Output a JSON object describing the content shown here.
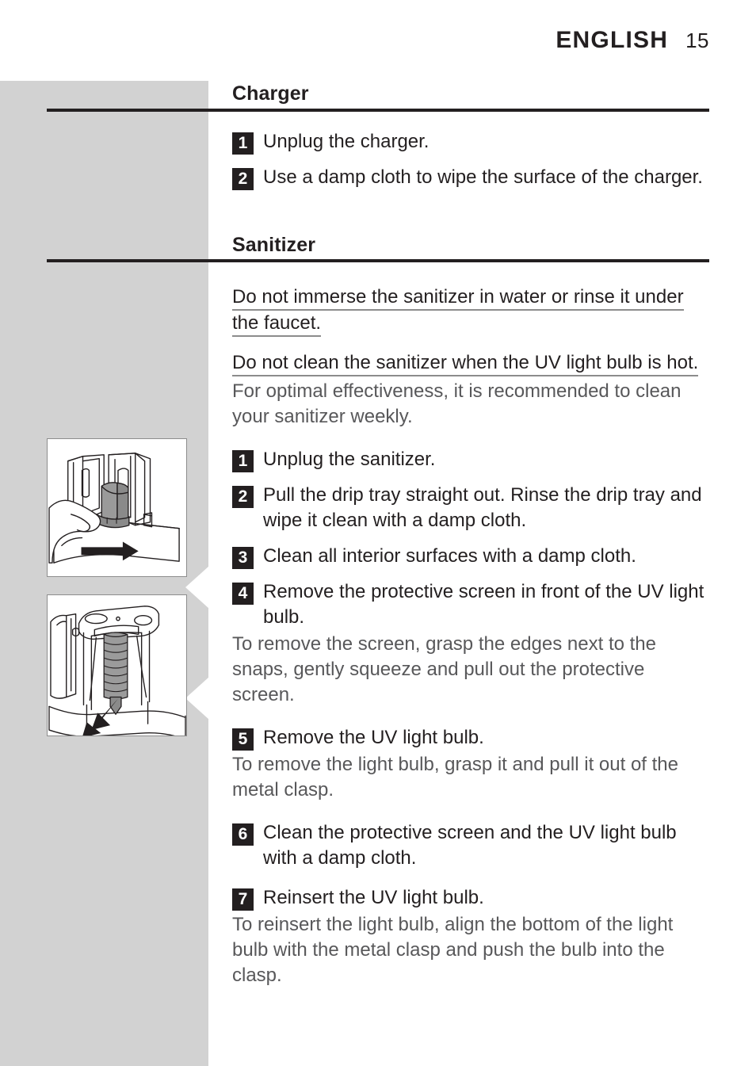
{
  "header": {
    "language": "ENGLISH",
    "page_number": "15"
  },
  "sections": [
    {
      "title": "Charger",
      "steps": [
        {
          "number": "1",
          "text": "Unplug the charger."
        },
        {
          "number": "2",
          "text": "Use a damp cloth to wipe the surface of the charger."
        }
      ]
    },
    {
      "title": "Sanitizer",
      "warnings": [
        "Do not immerse the sanitizer in water or rinse it under the faucet.",
        "Do not clean the sanitizer when the UV light bulb is hot."
      ],
      "intro": "For optimal effectiveness, it is recommended to clean your sanitizer weekly.",
      "steps": [
        {
          "number": "1",
          "text": "Unplug the sanitizer."
        },
        {
          "number": "2",
          "text": "Pull the drip tray straight out. Rinse the drip tray and wipe it clean with a damp cloth."
        },
        {
          "number": "3",
          "text": "Clean all interior surfaces with a damp cloth."
        },
        {
          "number": "4",
          "text": "Remove the protective screen in front of the UV light bulb."
        },
        {
          "number": "5",
          "text": "Remove the UV light bulb."
        },
        {
          "number": "6",
          "text": "Clean the protective screen and the UV light bulb with a damp cloth."
        },
        {
          "number": "7",
          "text": "Reinsert the UV light bulb."
        }
      ],
      "notes": {
        "after_step_4": "To remove the screen, grasp the edges next to the snaps, gently squeeze and pull out the protective screen.",
        "after_step_5": "To remove the light bulb, grasp it and pull it out of the metal clasp.",
        "after_step_7": "To reinsert the light bulb, align the bottom of the light bulb with the metal clasp and push the bulb into the clasp."
      }
    }
  ],
  "illustrations": [
    {
      "name": "drip-tray-removal-illustration",
      "caption": ""
    },
    {
      "name": "uv-bulb-removal-illustration",
      "caption": ""
    }
  ],
  "colors": {
    "ink": "#231f20",
    "body_text": "#58585a",
    "side_panel": "#d2d2d2",
    "rule": "#231f20",
    "underline": "#8c8c8c"
  }
}
